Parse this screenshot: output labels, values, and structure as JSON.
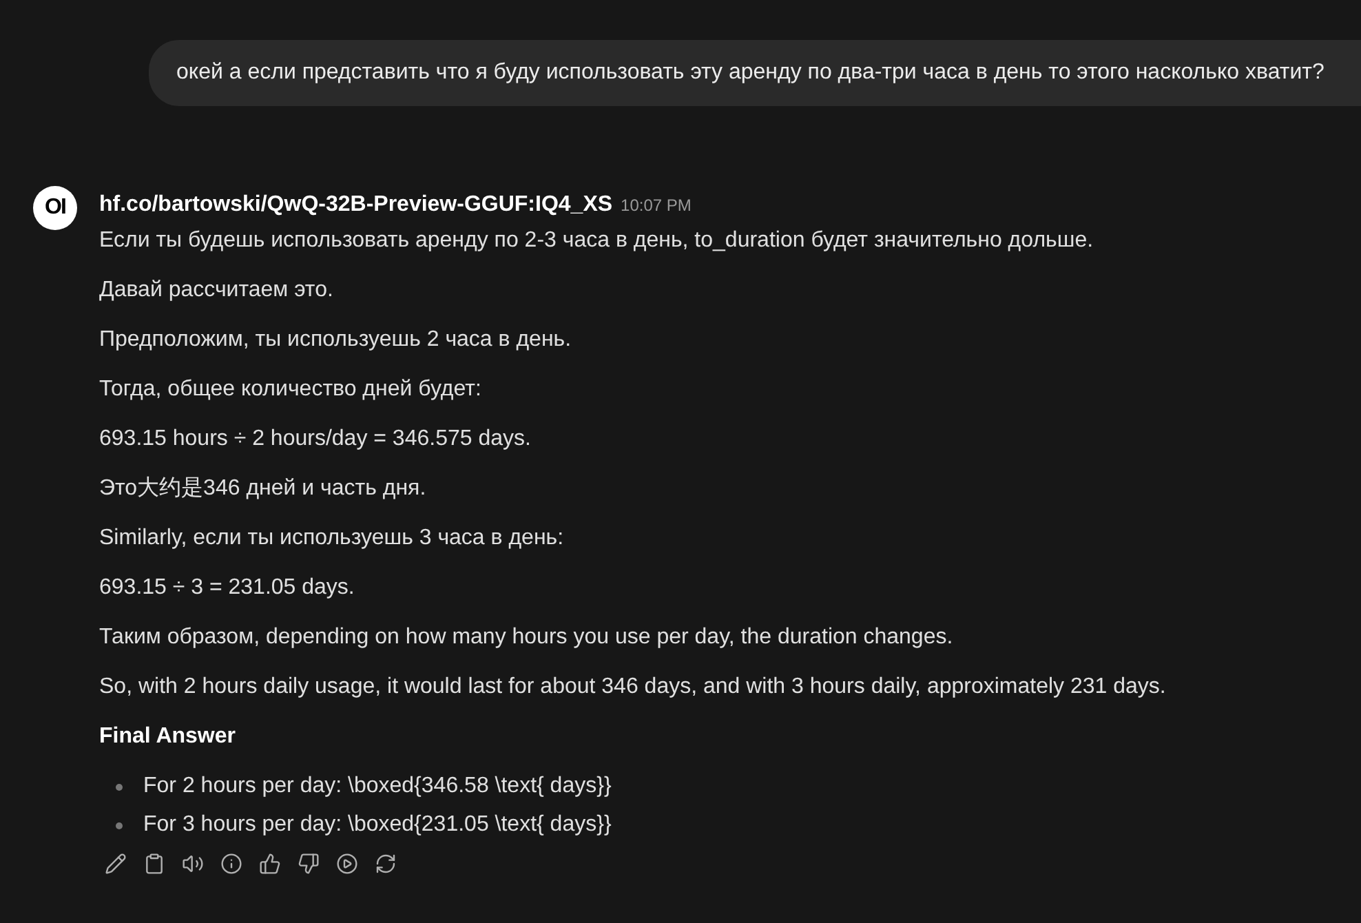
{
  "user_message": "окей а если представить что я буду использовать эту аренду по два-три часа в день то этого насколько хватит?",
  "assistant": {
    "avatar": "OI",
    "model": "hf.co/bartowski/QwQ-32B-Preview-GGUF:IQ4_XS",
    "time": "10:07 PM",
    "paragraphs": [
      "Если ты будешь использовать аренду по 2-3 часа в день, to_duration будет значительно дольше.",
      "Давай рассчитаем это.",
      "Предположим, ты используешь 2 часа в день.",
      "Тогда, общее количество дней будет:",
      "693.15 hours ÷ 2 hours/day = 346.575 days.",
      "Это大约是346 дней и часть дня.",
      "Similarly, если ты используешь 3 часа в день:",
      "693.15 ÷ 3 = 231.05 days.",
      "Таким образом, depending on how many hours you use per day, the duration changes.",
      "So, with 2 hours daily usage, it would last for about 346 days, and with 3 hours daily, approximately 231 days."
    ],
    "heading": "Final Answer",
    "bullets": [
      "For 2 hours per day: \\boxed{346.58 \\text{ days}}",
      "For 3 hours per day: \\boxed{231.05 \\text{ days}}"
    ],
    "actions": [
      {
        "kind": "edit"
      },
      {
        "kind": "copy"
      },
      {
        "kind": "speak"
      },
      {
        "kind": "info"
      },
      {
        "kind": "like"
      },
      {
        "kind": "dislike"
      },
      {
        "kind": "play"
      },
      {
        "kind": "regenerate"
      }
    ]
  }
}
